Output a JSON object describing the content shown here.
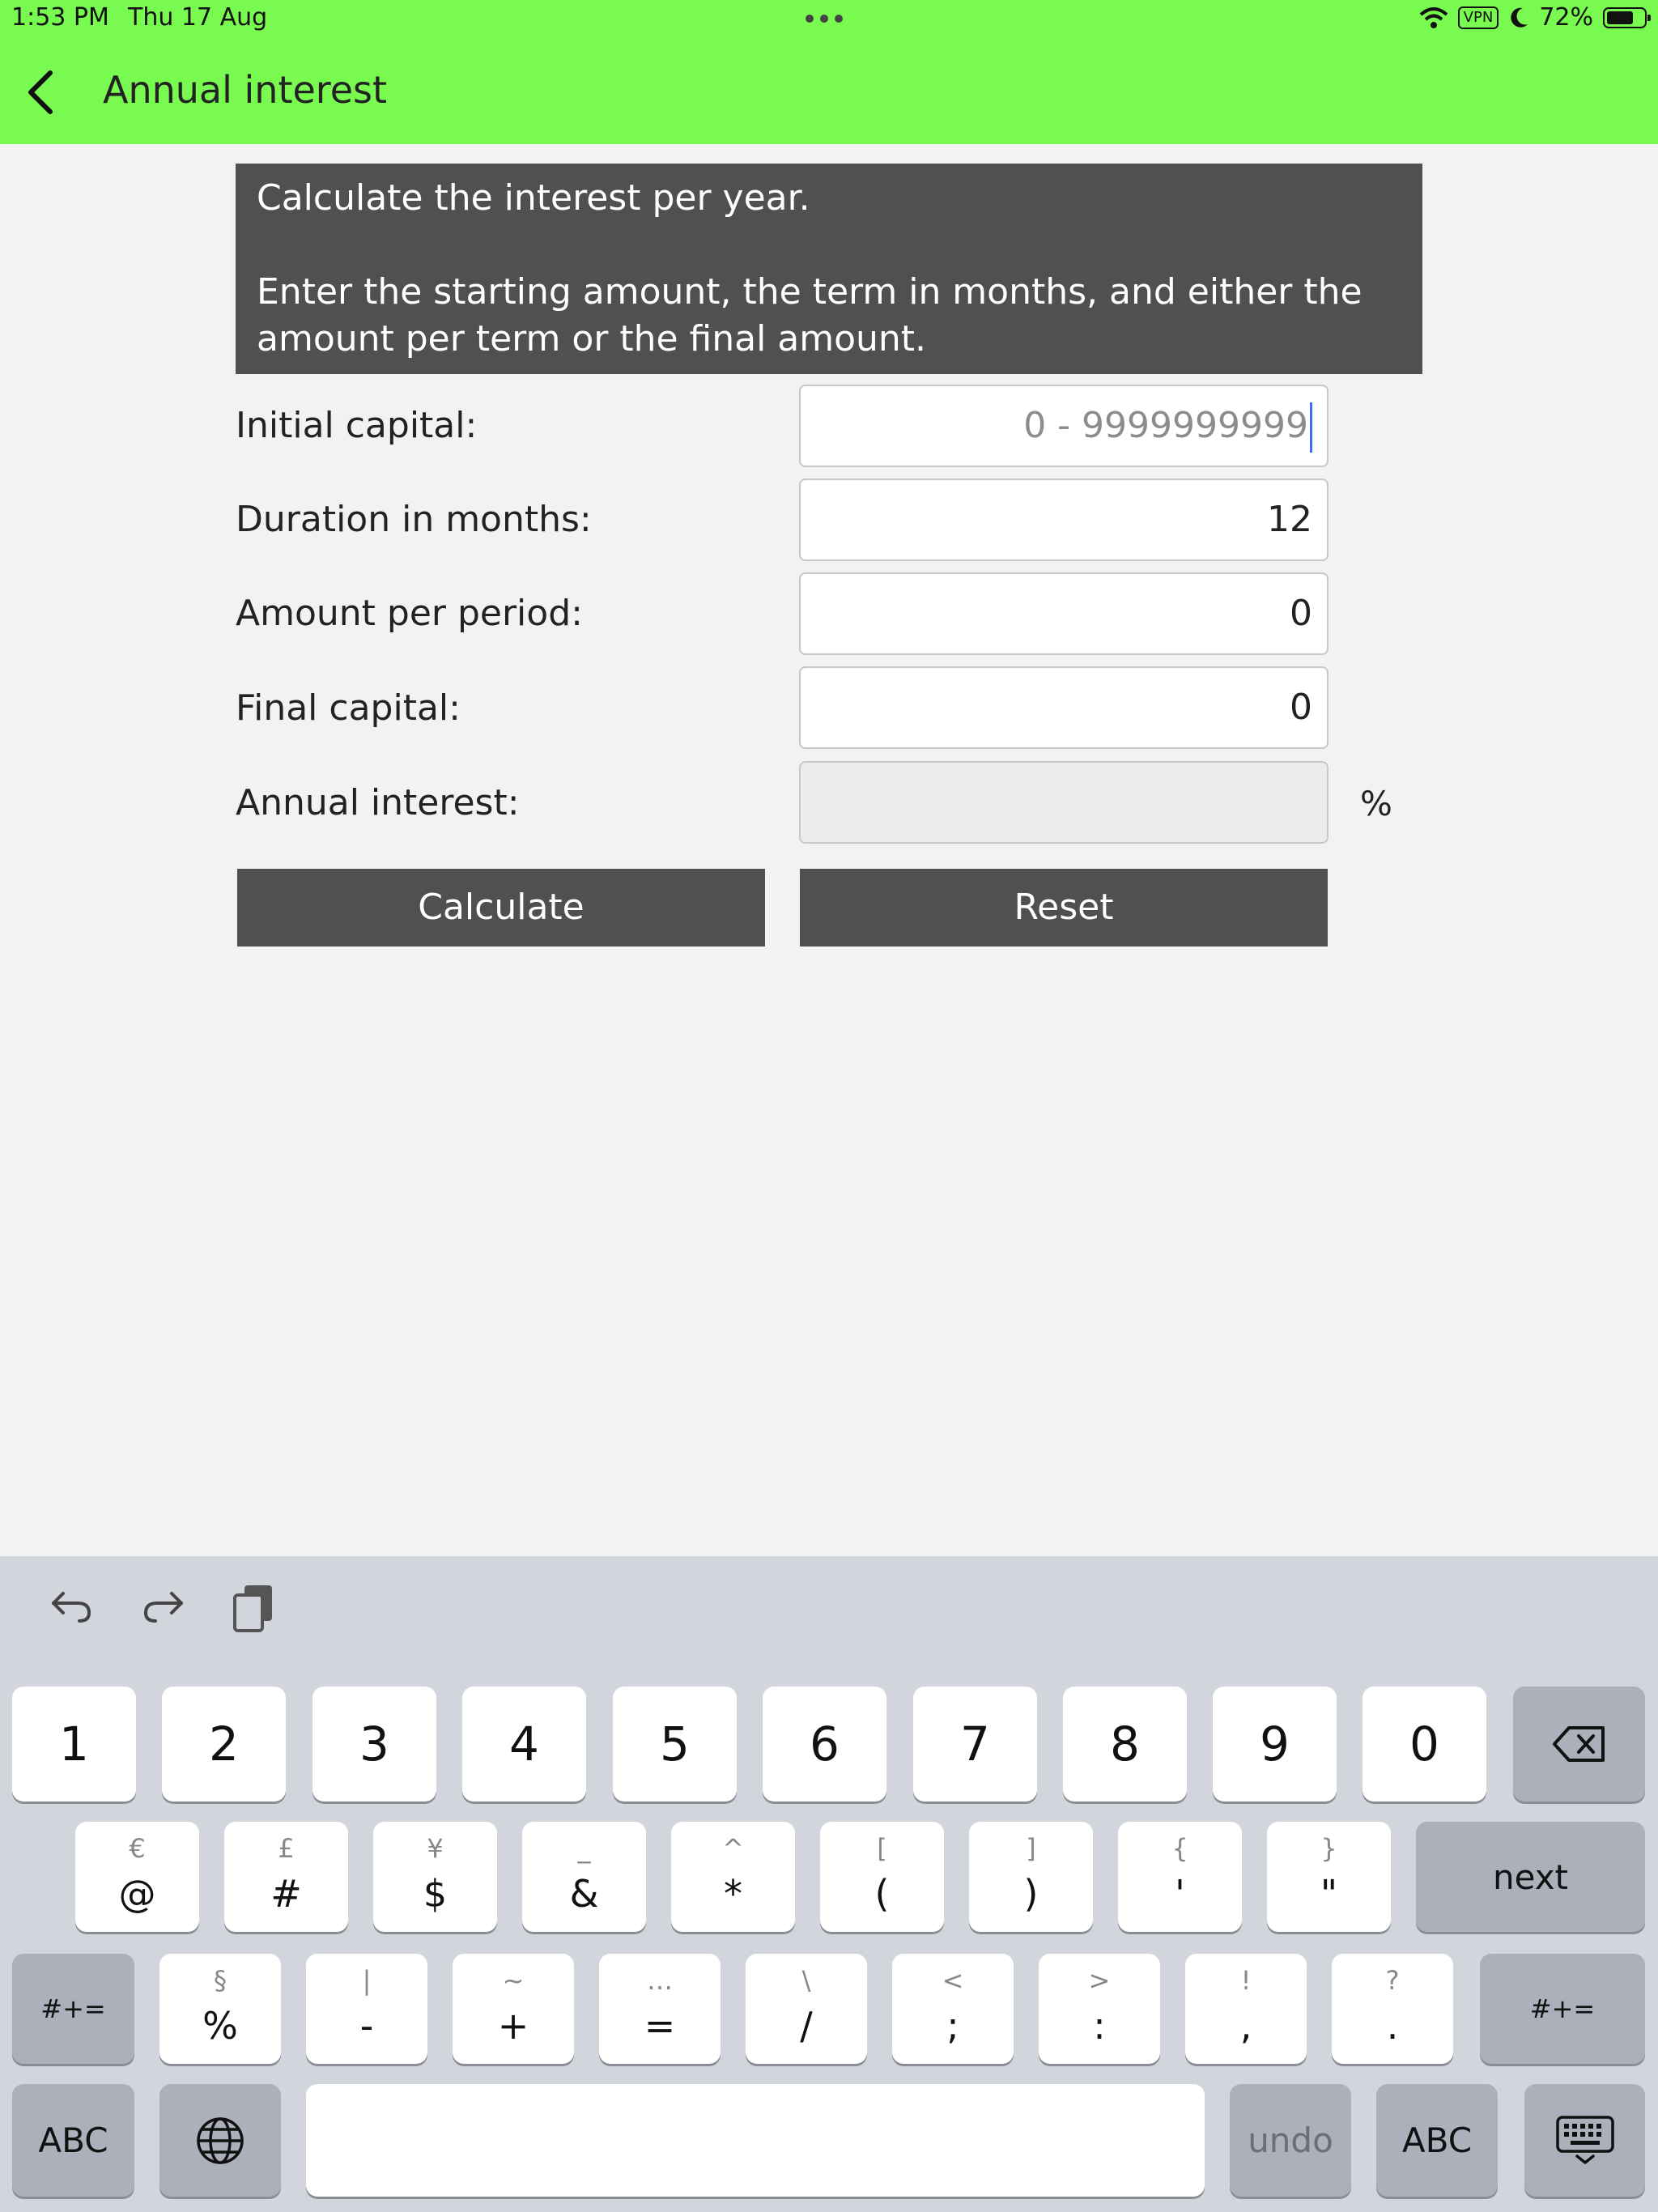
{
  "status_bar": {
    "time": "1:53 PM",
    "date": "Thu 17 Aug",
    "vpn": "VPN",
    "battery": "72%",
    "battery_level": 0.72
  },
  "nav": {
    "title": "Annual interest"
  },
  "info": {
    "line1": "Calculate the interest per year.",
    "line2": "Enter the starting amount, the term in months, and either the amount per term or the final amount."
  },
  "form": {
    "initial_capital_label": "Initial capital:",
    "initial_capital_placeholder": "0 - 9999999999",
    "initial_capital_value": "",
    "duration_label": "Duration in months:",
    "duration_value": "12",
    "amount_label": "Amount per period:",
    "amount_value": "0",
    "final_label": "Final capital:",
    "final_value": "0",
    "interest_label": "Annual interest:",
    "interest_value": "",
    "percent": "%"
  },
  "buttons": {
    "calculate": "Calculate",
    "reset": "Reset"
  },
  "keyboard": {
    "row1": [
      "1",
      "2",
      "3",
      "4",
      "5",
      "6",
      "7",
      "8",
      "9",
      "0"
    ],
    "row2": [
      {
        "alt": "€",
        "main": "@"
      },
      {
        "alt": "£",
        "main": "#"
      },
      {
        "alt": "¥",
        "main": "$"
      },
      {
        "alt": "_",
        "main": "&"
      },
      {
        "alt": "^",
        "main": "*"
      },
      {
        "alt": "[",
        "main": "("
      },
      {
        "alt": "]",
        "main": ")"
      },
      {
        "alt": "{",
        "main": "'"
      },
      {
        "alt": "}",
        "main": "\""
      }
    ],
    "row3": [
      {
        "alt": "§",
        "main": "%"
      },
      {
        "alt": "|",
        "main": "-"
      },
      {
        "alt": "~",
        "main": "+"
      },
      {
        "alt": "…",
        "main": "="
      },
      {
        "alt": "\\",
        "main": "/"
      },
      {
        "alt": "<",
        "main": ";"
      },
      {
        "alt": ">",
        "main": ":"
      },
      {
        "alt": "!",
        "main": ","
      },
      {
        "alt": "?",
        "main": "."
      }
    ],
    "next": "next",
    "shift_left": "#+=",
    "shift_right": "#+=",
    "abc_left": "ABC",
    "abc_right": "ABC",
    "undo": "undo",
    "space": ""
  }
}
